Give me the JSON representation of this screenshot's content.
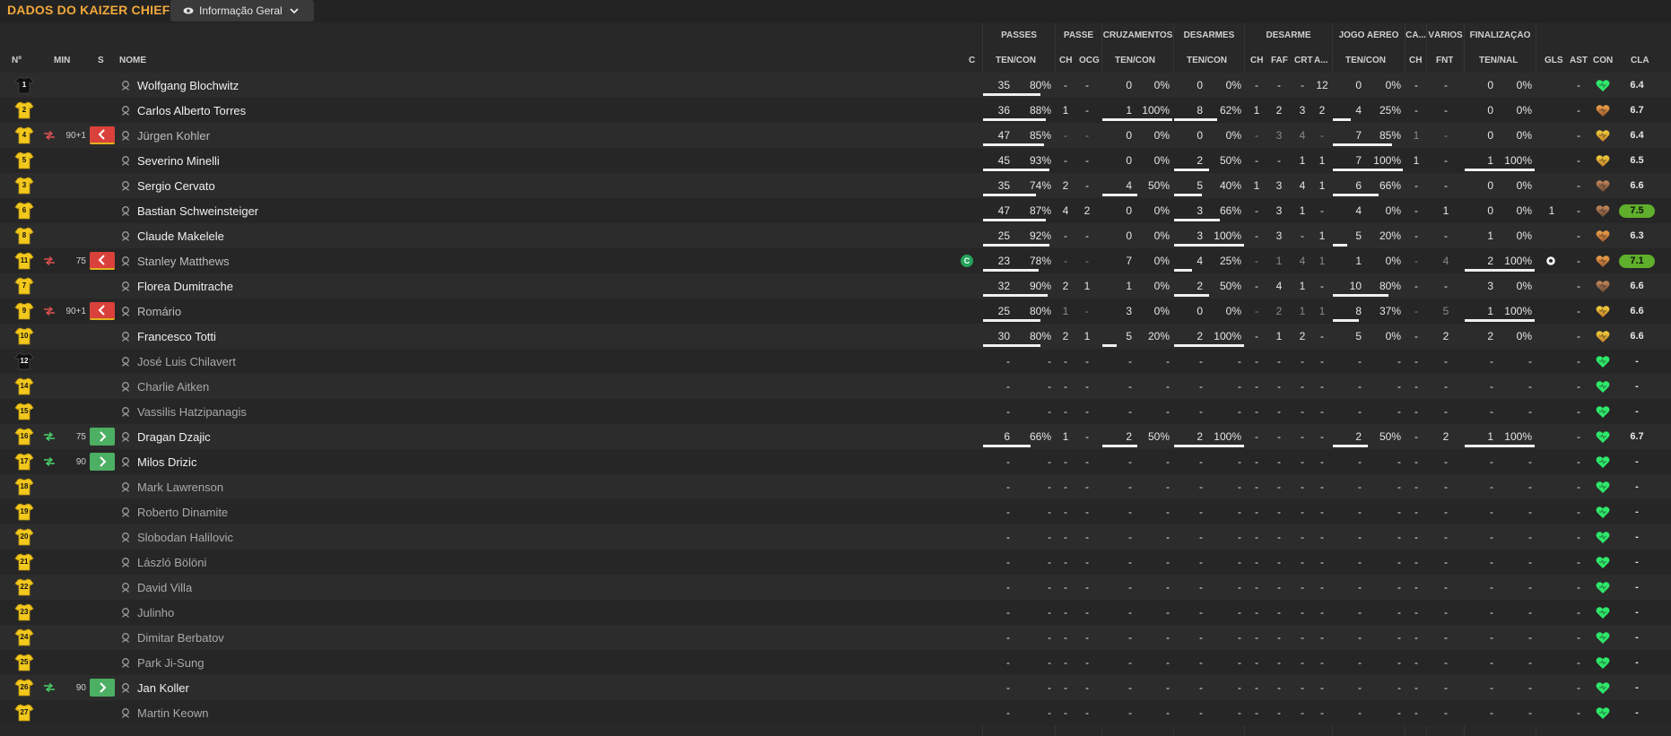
{
  "header": {
    "title": "DADOS DO KAIZER CHIEFS",
    "view_label": "Informação Geral"
  },
  "groups": [
    "PASSES",
    "PASSE",
    "CRUZAMENTOS",
    "DESARMES",
    "DESARME",
    "JOGO AÉREO",
    "CA...",
    "VÁRIOS",
    "FINALIZAÇÃO"
  ],
  "columns": {
    "num": "Nº",
    "min": "MIN",
    "s": "S",
    "nome": "NOME",
    "c": "C",
    "passes": "TEN/CON",
    "passe_ch": "CH",
    "passe_ocg": "OCG",
    "cruz": "TEN/CON",
    "desarmes": "TEN/CON",
    "des_ch": "CH",
    "des_faf": "FAF",
    "des_crt": "CRT",
    "des_a": "A...",
    "aereo": "TEN/CON",
    "ca_ch": "CH",
    "var_fnt": "FNT",
    "final": "TEN/NAL",
    "gls": "GLS",
    "ast": "AST",
    "con": "CON",
    "cla": "CLA"
  },
  "colors": {
    "accent": "#f2a83b",
    "sub_out": "#d9413a",
    "sub_in": "#4caf63",
    "rating_high": "#5fae2c",
    "heart_green": "#2ee86a"
  },
  "players": [
    {
      "num": "1",
      "gk": true,
      "min": "",
      "sub": "",
      "name": "Wolfgang Blochwitz",
      "status": "played",
      "pa": "35",
      "pp": "80%",
      "pbar": 0.8,
      "pch": "-",
      "pocg": "-",
      "ca": "0",
      "cp": "0%",
      "cbar": 0,
      "da": "0",
      "dp": "0%",
      "dbar": 0,
      "dch": "-",
      "dfaf": "-",
      "dcrt": "-",
      "dA": "12",
      "aa": "0",
      "ap": "0%",
      "abar": 0,
      "cach": "-",
      "fnt": "-",
      "fa": "0",
      "fp": "0%",
      "fbar": 0,
      "gls": "",
      "ast": "-",
      "con": "green",
      "cla": "6.4",
      "high": false,
      "capt": false,
      "goal": false
    },
    {
      "num": "2",
      "gk": false,
      "min": "",
      "sub": "",
      "name": "Carlos Alberto Torres",
      "status": "played",
      "pa": "36",
      "pp": "88%",
      "pbar": 0.88,
      "pch": "1",
      "pocg": "-",
      "ca": "1",
      "cp": "100%",
      "cbar": 1,
      "da": "8",
      "dp": "62%",
      "dbar": 0.62,
      "dch": "1",
      "dfaf": "2",
      "dcrt": "3",
      "dA": "2",
      "aa": "4",
      "ap": "25%",
      "abar": 0.25,
      "cach": "-",
      "fnt": "-",
      "fa": "0",
      "fp": "0%",
      "fbar": 0,
      "gls": "",
      "ast": "-",
      "con": "orange",
      "cla": "6.7",
      "high": false,
      "capt": false,
      "goal": false
    },
    {
      "num": "4",
      "gk": false,
      "min": "90+1",
      "sub": "out",
      "name": "Jürgen Kohler",
      "status": "subbed",
      "pa": "47",
      "pp": "85%",
      "pbar": 0.85,
      "pch": "-",
      "pocg": "-",
      "ca": "0",
      "cp": "0%",
      "cbar": 0,
      "da": "0",
      "dp": "0%",
      "dbar": 0,
      "dch": "-",
      "dfaf": "3",
      "dcrt": "4",
      "dA": "-",
      "aa": "7",
      "ap": "85%",
      "abar": 0.85,
      "cach": "1",
      "fnt": "-",
      "fa": "0",
      "fp": "0%",
      "fbar": 0,
      "gls": "",
      "ast": "-",
      "con": "yellow",
      "cla": "6.4",
      "high": false,
      "capt": false,
      "goal": false
    },
    {
      "num": "5",
      "gk": false,
      "min": "",
      "sub": "",
      "name": "Severino Minelli",
      "status": "played",
      "pa": "45",
      "pp": "93%",
      "pbar": 0.93,
      "pch": "-",
      "pocg": "-",
      "ca": "0",
      "cp": "0%",
      "cbar": 0,
      "da": "2",
      "dp": "50%",
      "dbar": 0.5,
      "dch": "-",
      "dfaf": "-",
      "dcrt": "1",
      "dA": "1",
      "aa": "7",
      "ap": "100%",
      "abar": 1,
      "cach": "1",
      "fnt": "-",
      "fa": "1",
      "fp": "100%",
      "fbar": 1,
      "gls": "",
      "ast": "-",
      "con": "yellow",
      "cla": "6.5",
      "high": false,
      "capt": false,
      "goal": false
    },
    {
      "num": "3",
      "gk": false,
      "min": "",
      "sub": "",
      "name": "Sergio Cervato",
      "status": "played",
      "pa": "35",
      "pp": "74%",
      "pbar": 0.74,
      "pch": "2",
      "pocg": "-",
      "ca": "4",
      "cp": "50%",
      "cbar": 0.5,
      "da": "5",
      "dp": "40%",
      "dbar": 0.4,
      "dch": "1",
      "dfaf": "3",
      "dcrt": "4",
      "dA": "1",
      "aa": "6",
      "ap": "66%",
      "abar": 0.66,
      "cach": "-",
      "fnt": "-",
      "fa": "0",
      "fp": "0%",
      "fbar": 0,
      "gls": "",
      "ast": "-",
      "con": "brown",
      "cla": "6.6",
      "high": false,
      "capt": false,
      "goal": false
    },
    {
      "num": "6",
      "gk": false,
      "min": "",
      "sub": "",
      "name": "Bastian Schweinsteiger",
      "status": "played",
      "pa": "47",
      "pp": "87%",
      "pbar": 0.87,
      "pch": "4",
      "pocg": "2",
      "ca": "0",
      "cp": "0%",
      "cbar": 0,
      "da": "3",
      "dp": "66%",
      "dbar": 0.66,
      "dch": "-",
      "dfaf": "3",
      "dcrt": "1",
      "dA": "-",
      "aa": "4",
      "ap": "0%",
      "abar": 0,
      "cach": "-",
      "fnt": "1",
      "fa": "0",
      "fp": "0%",
      "fbar": 0,
      "gls": "1",
      "ast": "-",
      "con": "brown",
      "cla": "7.5",
      "high": true,
      "capt": false,
      "goal": false
    },
    {
      "num": "8",
      "gk": false,
      "min": "",
      "sub": "",
      "name": "Claude Makelele",
      "status": "played",
      "pa": "25",
      "pp": "92%",
      "pbar": 0.92,
      "pch": "-",
      "pocg": "-",
      "ca": "0",
      "cp": "0%",
      "cbar": 0,
      "da": "3",
      "dp": "100%",
      "dbar": 1,
      "dch": "-",
      "dfaf": "3",
      "dcrt": "-",
      "dA": "1",
      "aa": "5",
      "ap": "20%",
      "abar": 0.2,
      "cach": "-",
      "fnt": "-",
      "fa": "1",
      "fp": "0%",
      "fbar": 0,
      "gls": "",
      "ast": "-",
      "con": "orange",
      "cla": "6.3",
      "high": false,
      "capt": false,
      "goal": false
    },
    {
      "num": "11",
      "gk": false,
      "min": "75",
      "sub": "out",
      "name": "Stanley Matthews",
      "status": "subbed",
      "pa": "23",
      "pp": "78%",
      "pbar": 0.78,
      "pch": "-",
      "pocg": "-",
      "ca": "7",
      "cp": "0%",
      "cbar": 0,
      "da": "4",
      "dp": "25%",
      "dbar": 0.25,
      "dch": "-",
      "dfaf": "1",
      "dcrt": "4",
      "dA": "1",
      "aa": "1",
      "ap": "0%",
      "abar": 0,
      "cach": "-",
      "fnt": "4",
      "fa": "2",
      "fp": "100%",
      "fbar": 1,
      "gls": "",
      "ast": "-",
      "con": "orange",
      "cla": "7.1",
      "high": true,
      "capt": true,
      "goal": true
    },
    {
      "num": "7",
      "gk": false,
      "min": "",
      "sub": "",
      "name": "Florea Dumitrache",
      "status": "played",
      "pa": "32",
      "pp": "90%",
      "pbar": 0.9,
      "pch": "2",
      "pocg": "1",
      "ca": "1",
      "cp": "0%",
      "cbar": 0,
      "da": "2",
      "dp": "50%",
      "dbar": 0.5,
      "dch": "-",
      "dfaf": "4",
      "dcrt": "1",
      "dA": "-",
      "aa": "10",
      "ap": "80%",
      "abar": 0.8,
      "cach": "-",
      "fnt": "-",
      "fa": "3",
      "fp": "0%",
      "fbar": 0,
      "gls": "",
      "ast": "-",
      "con": "brown",
      "cla": "6.6",
      "high": false,
      "capt": false,
      "goal": false
    },
    {
      "num": "9",
      "gk": false,
      "min": "90+1",
      "sub": "out",
      "name": "Romário",
      "status": "subbed",
      "pa": "25",
      "pp": "80%",
      "pbar": 0.8,
      "pch": "1",
      "pocg": "-",
      "ca": "3",
      "cp": "0%",
      "cbar": 0,
      "da": "0",
      "dp": "0%",
      "dbar": 0,
      "dch": "-",
      "dfaf": "2",
      "dcrt": "1",
      "dA": "1",
      "aa": "8",
      "ap": "37%",
      "abar": 0.37,
      "cach": "-",
      "fnt": "5",
      "fa": "1",
      "fp": "100%",
      "fbar": 1,
      "gls": "",
      "ast": "-",
      "con": "yellow",
      "cla": "6.6",
      "high": false,
      "capt": false,
      "goal": false
    },
    {
      "num": "10",
      "gk": false,
      "min": "",
      "sub": "",
      "name": "Francesco Totti",
      "status": "played",
      "pa": "30",
      "pp": "80%",
      "pbar": 0.8,
      "pch": "2",
      "pocg": "1",
      "ca": "5",
      "cp": "20%",
      "cbar": 0.2,
      "da": "2",
      "dp": "100%",
      "dbar": 1,
      "dch": "-",
      "dfaf": "1",
      "dcrt": "2",
      "dA": "-",
      "aa": "5",
      "ap": "0%",
      "abar": 0,
      "cach": "-",
      "fnt": "2",
      "fa": "2",
      "fp": "0%",
      "fbar": 0,
      "gls": "",
      "ast": "-",
      "con": "yellow",
      "cla": "6.6",
      "high": false,
      "capt": false,
      "goal": false
    },
    {
      "num": "12",
      "gk": true,
      "min": "",
      "sub": "",
      "name": "José Luis Chilavert",
      "status": "unused",
      "pa": "-",
      "pp": "-",
      "pbar": 0,
      "pch": "-",
      "pocg": "-",
      "ca": "-",
      "cp": "-",
      "cbar": 0,
      "da": "-",
      "dp": "-",
      "dbar": 0,
      "dch": "-",
      "dfaf": "-",
      "dcrt": "-",
      "dA": "-",
      "aa": "-",
      "ap": "-",
      "abar": 0,
      "cach": "-",
      "fnt": "-",
      "fa": "-",
      "fp": "-",
      "fbar": 0,
      "gls": "",
      "ast": "-",
      "con": "green",
      "cla": "-",
      "high": false,
      "capt": false,
      "goal": false
    },
    {
      "num": "14",
      "gk": false,
      "min": "",
      "sub": "",
      "name": "Charlie Aitken",
      "status": "unused",
      "pa": "-",
      "pp": "-",
      "pbar": 0,
      "pch": "-",
      "pocg": "-",
      "ca": "-",
      "cp": "-",
      "cbar": 0,
      "da": "-",
      "dp": "-",
      "dbar": 0,
      "dch": "-",
      "dfaf": "-",
      "dcrt": "-",
      "dA": "-",
      "aa": "-",
      "ap": "-",
      "abar": 0,
      "cach": "-",
      "fnt": "-",
      "fa": "-",
      "fp": "-",
      "fbar": 0,
      "gls": "",
      "ast": "-",
      "con": "green",
      "cla": "-",
      "high": false,
      "capt": false,
      "goal": false
    },
    {
      "num": "15",
      "gk": false,
      "min": "",
      "sub": "",
      "name": "Vassilis Hatzipanagis",
      "status": "unused",
      "pa": "-",
      "pp": "-",
      "pbar": 0,
      "pch": "-",
      "pocg": "-",
      "ca": "-",
      "cp": "-",
      "cbar": 0,
      "da": "-",
      "dp": "-",
      "dbar": 0,
      "dch": "-",
      "dfaf": "-",
      "dcrt": "-",
      "dA": "-",
      "aa": "-",
      "ap": "-",
      "abar": 0,
      "cach": "-",
      "fnt": "-",
      "fa": "-",
      "fp": "-",
      "fbar": 0,
      "gls": "",
      "ast": "-",
      "con": "green",
      "cla": "-",
      "high": false,
      "capt": false,
      "goal": false
    },
    {
      "num": "16",
      "gk": false,
      "min": "75",
      "sub": "in",
      "name": "Dragan Dzajic",
      "status": "played",
      "pa": "6",
      "pp": "66%",
      "pbar": 0.66,
      "pch": "1",
      "pocg": "-",
      "ca": "2",
      "cp": "50%",
      "cbar": 0.5,
      "da": "2",
      "dp": "100%",
      "dbar": 1,
      "dch": "-",
      "dfaf": "-",
      "dcrt": "-",
      "dA": "-",
      "aa": "2",
      "ap": "50%",
      "abar": 0.5,
      "cach": "-",
      "fnt": "2",
      "fa": "1",
      "fp": "100%",
      "fbar": 1,
      "gls": "",
      "ast": "-",
      "con": "green",
      "cla": "6.7",
      "high": false,
      "capt": false,
      "goal": false
    },
    {
      "num": "17",
      "gk": false,
      "min": "90",
      "sub": "in",
      "name": "Milos Drizic",
      "status": "played",
      "pa": "-",
      "pp": "-",
      "pbar": 0,
      "pch": "-",
      "pocg": "-",
      "ca": "-",
      "cp": "-",
      "cbar": 0,
      "da": "-",
      "dp": "-",
      "dbar": 0,
      "dch": "-",
      "dfaf": "-",
      "dcrt": "-",
      "dA": "-",
      "aa": "-",
      "ap": "-",
      "abar": 0,
      "cach": "-",
      "fnt": "-",
      "fa": "-",
      "fp": "-",
      "fbar": 0,
      "gls": "",
      "ast": "-",
      "con": "green",
      "cla": "-",
      "high": false,
      "capt": false,
      "goal": false
    },
    {
      "num": "18",
      "gk": false,
      "min": "",
      "sub": "",
      "name": "Mark Lawrenson",
      "status": "unused",
      "pa": "-",
      "pp": "-",
      "pbar": 0,
      "pch": "-",
      "pocg": "-",
      "ca": "-",
      "cp": "-",
      "cbar": 0,
      "da": "-",
      "dp": "-",
      "dbar": 0,
      "dch": "-",
      "dfaf": "-",
      "dcrt": "-",
      "dA": "-",
      "aa": "-",
      "ap": "-",
      "abar": 0,
      "cach": "-",
      "fnt": "-",
      "fa": "-",
      "fp": "-",
      "fbar": 0,
      "gls": "",
      "ast": "-",
      "con": "green",
      "cla": "-",
      "high": false,
      "capt": false,
      "goal": false
    },
    {
      "num": "19",
      "gk": false,
      "min": "",
      "sub": "",
      "name": "Roberto Dinamite",
      "status": "unused",
      "pa": "-",
      "pp": "-",
      "pbar": 0,
      "pch": "-",
      "pocg": "-",
      "ca": "-",
      "cp": "-",
      "cbar": 0,
      "da": "-",
      "dp": "-",
      "dbar": 0,
      "dch": "-",
      "dfaf": "-",
      "dcrt": "-",
      "dA": "-",
      "aa": "-",
      "ap": "-",
      "abar": 0,
      "cach": "-",
      "fnt": "-",
      "fa": "-",
      "fp": "-",
      "fbar": 0,
      "gls": "",
      "ast": "-",
      "con": "green",
      "cla": "-",
      "high": false,
      "capt": false,
      "goal": false
    },
    {
      "num": "20",
      "gk": false,
      "min": "",
      "sub": "",
      "name": "Slobodan Halilovic",
      "status": "unused",
      "pa": "-",
      "pp": "-",
      "pbar": 0,
      "pch": "-",
      "pocg": "-",
      "ca": "-",
      "cp": "-",
      "cbar": 0,
      "da": "-",
      "dp": "-",
      "dbar": 0,
      "dch": "-",
      "dfaf": "-",
      "dcrt": "-",
      "dA": "-",
      "aa": "-",
      "ap": "-",
      "abar": 0,
      "cach": "-",
      "fnt": "-",
      "fa": "-",
      "fp": "-",
      "fbar": 0,
      "gls": "",
      "ast": "-",
      "con": "green",
      "cla": "-",
      "high": false,
      "capt": false,
      "goal": false
    },
    {
      "num": "21",
      "gk": false,
      "min": "",
      "sub": "",
      "name": "László Bölöni",
      "status": "unused",
      "pa": "-",
      "pp": "-",
      "pbar": 0,
      "pch": "-",
      "pocg": "-",
      "ca": "-",
      "cp": "-",
      "cbar": 0,
      "da": "-",
      "dp": "-",
      "dbar": 0,
      "dch": "-",
      "dfaf": "-",
      "dcrt": "-",
      "dA": "-",
      "aa": "-",
      "ap": "-",
      "abar": 0,
      "cach": "-",
      "fnt": "-",
      "fa": "-",
      "fp": "-",
      "fbar": 0,
      "gls": "",
      "ast": "-",
      "con": "green",
      "cla": "-",
      "high": false,
      "capt": false,
      "goal": false
    },
    {
      "num": "22",
      "gk": false,
      "min": "",
      "sub": "",
      "name": "David Villa",
      "status": "unused",
      "pa": "-",
      "pp": "-",
      "pbar": 0,
      "pch": "-",
      "pocg": "-",
      "ca": "-",
      "cp": "-",
      "cbar": 0,
      "da": "-",
      "dp": "-",
      "dbar": 0,
      "dch": "-",
      "dfaf": "-",
      "dcrt": "-",
      "dA": "-",
      "aa": "-",
      "ap": "-",
      "abar": 0,
      "cach": "-",
      "fnt": "-",
      "fa": "-",
      "fp": "-",
      "fbar": 0,
      "gls": "",
      "ast": "-",
      "con": "green",
      "cla": "-",
      "high": false,
      "capt": false,
      "goal": false
    },
    {
      "num": "23",
      "gk": false,
      "min": "",
      "sub": "",
      "name": "Julinho",
      "status": "unused",
      "pa": "-",
      "pp": "-",
      "pbar": 0,
      "pch": "-",
      "pocg": "-",
      "ca": "-",
      "cp": "-",
      "cbar": 0,
      "da": "-",
      "dp": "-",
      "dbar": 0,
      "dch": "-",
      "dfaf": "-",
      "dcrt": "-",
      "dA": "-",
      "aa": "-",
      "ap": "-",
      "abar": 0,
      "cach": "-",
      "fnt": "-",
      "fa": "-",
      "fp": "-",
      "fbar": 0,
      "gls": "",
      "ast": "-",
      "con": "green",
      "cla": "-",
      "high": false,
      "capt": false,
      "goal": false
    },
    {
      "num": "24",
      "gk": false,
      "min": "",
      "sub": "",
      "name": "Dimitar Berbatov",
      "status": "unused",
      "pa": "-",
      "pp": "-",
      "pbar": 0,
      "pch": "-",
      "pocg": "-",
      "ca": "-",
      "cp": "-",
      "cbar": 0,
      "da": "-",
      "dp": "-",
      "dbar": 0,
      "dch": "-",
      "dfaf": "-",
      "dcrt": "-",
      "dA": "-",
      "aa": "-",
      "ap": "-",
      "abar": 0,
      "cach": "-",
      "fnt": "-",
      "fa": "-",
      "fp": "-",
      "fbar": 0,
      "gls": "",
      "ast": "-",
      "con": "green",
      "cla": "-",
      "high": false,
      "capt": false,
      "goal": false
    },
    {
      "num": "25",
      "gk": false,
      "min": "",
      "sub": "",
      "name": "Park Ji-Sung",
      "status": "unused",
      "pa": "-",
      "pp": "-",
      "pbar": 0,
      "pch": "-",
      "pocg": "-",
      "ca": "-",
      "cp": "-",
      "cbar": 0,
      "da": "-",
      "dp": "-",
      "dbar": 0,
      "dch": "-",
      "dfaf": "-",
      "dcrt": "-",
      "dA": "-",
      "aa": "-",
      "ap": "-",
      "abar": 0,
      "cach": "-",
      "fnt": "-",
      "fa": "-",
      "fp": "-",
      "fbar": 0,
      "gls": "",
      "ast": "-",
      "con": "green",
      "cla": "-",
      "high": false,
      "capt": false,
      "goal": false
    },
    {
      "num": "26",
      "gk": false,
      "min": "90",
      "sub": "in",
      "name": "Jan Koller",
      "status": "played",
      "pa": "-",
      "pp": "-",
      "pbar": 0,
      "pch": "-",
      "pocg": "-",
      "ca": "-",
      "cp": "-",
      "cbar": 0,
      "da": "-",
      "dp": "-",
      "dbar": 0,
      "dch": "-",
      "dfaf": "-",
      "dcrt": "-",
      "dA": "-",
      "aa": "-",
      "ap": "-",
      "abar": 0,
      "cach": "-",
      "fnt": "-",
      "fa": "-",
      "fp": "-",
      "fbar": 0,
      "gls": "",
      "ast": "-",
      "con": "green",
      "cla": "-",
      "high": false,
      "capt": false,
      "goal": false
    },
    {
      "num": "27",
      "gk": false,
      "min": "",
      "sub": "",
      "name": "Martin Keown",
      "status": "unused",
      "pa": "-",
      "pp": "-",
      "pbar": 0,
      "pch": "-",
      "pocg": "-",
      "ca": "-",
      "cp": "-",
      "cbar": 0,
      "da": "-",
      "dp": "-",
      "dbar": 0,
      "dch": "-",
      "dfaf": "-",
      "dcrt": "-",
      "dA": "-",
      "aa": "-",
      "ap": "-",
      "abar": 0,
      "cach": "-",
      "fnt": "-",
      "fa": "-",
      "fp": "-",
      "fbar": 0,
      "gls": "",
      "ast": "-",
      "con": "green",
      "cla": "-",
      "high": false,
      "capt": false,
      "goal": false
    }
  ]
}
